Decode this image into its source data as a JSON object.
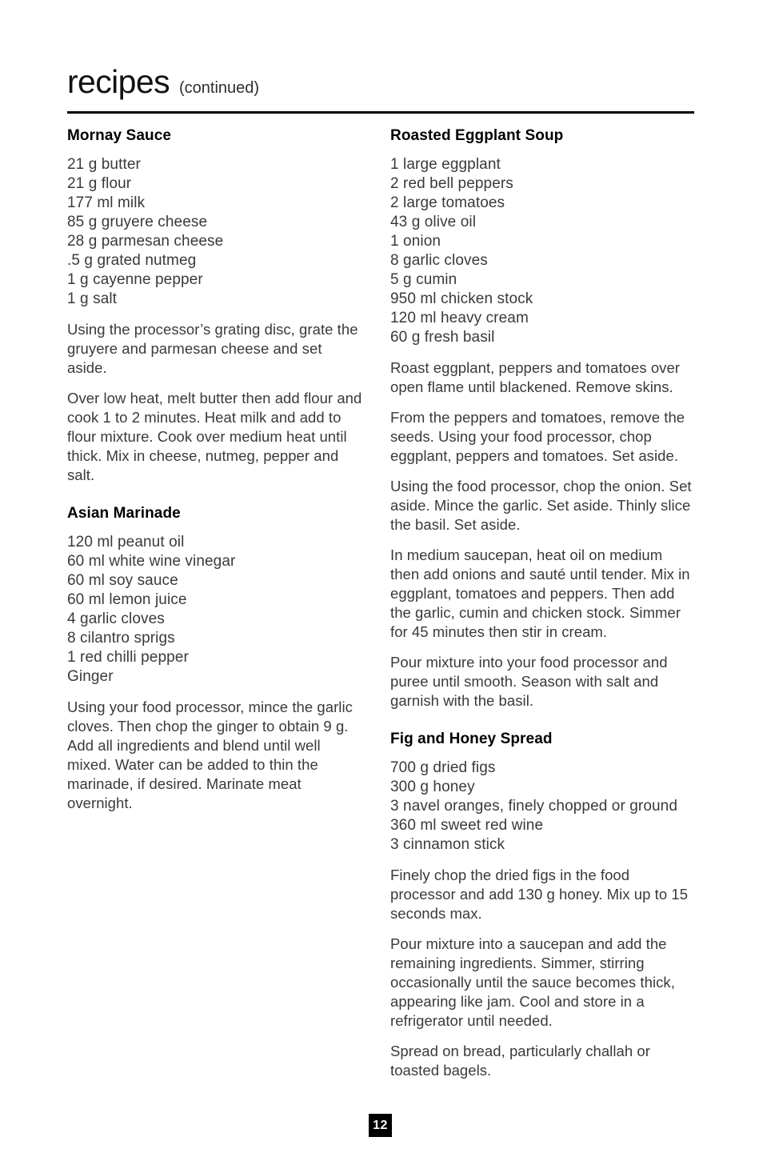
{
  "header": {
    "title": "recipes",
    "subtitle": "(continued)"
  },
  "columns": {
    "left": [
      {
        "title": "Mornay Sauce",
        "ingredients": [
          "21 g butter",
          "21 g flour",
          "177 ml milk",
          "85 g gruyere cheese",
          "28 g parmesan cheese",
          ".5 g grated nutmeg",
          "1 g cayenne pepper",
          "1 g salt"
        ],
        "steps": [
          "Using the processor’s grating disc, grate the gruyere and parmesan cheese and set aside.",
          "Over low heat, melt butter then add flour and cook 1 to 2 minutes.  Heat milk and add to flour mixture.  Cook over medium heat until thick.  Mix in cheese, nutmeg, pepper and salt."
        ]
      },
      {
        "title": "Asian Marinade",
        "ingredients": [
          "120 ml peanut oil",
          "60 ml white wine vinegar",
          "60 ml soy sauce",
          "60 ml lemon juice",
          "4 garlic cloves",
          "8 cilantro sprigs",
          "1 red chilli pepper",
          "Ginger"
        ],
        "steps": [
          "Using your food processor, mince the garlic cloves. Then chop the ginger to obtain 9 g. Add all ingredients and blend until well mixed. Water can be added to thin the marinade, if desired.  Marinate meat overnight."
        ]
      }
    ],
    "right": [
      {
        "title": "Roasted Eggplant Soup",
        "ingredients": [
          "1 large eggplant",
          "2 red bell peppers",
          "2 large tomatoes",
          "43 g olive oil",
          "1 onion",
          "8 garlic cloves",
          "5 g cumin",
          "950 ml chicken stock",
          "120 ml heavy cream",
          "60 g fresh basil"
        ],
        "steps": [
          "Roast eggplant, peppers and tomatoes over open flame until blackened.  Remove skins.",
          "From the peppers and tomatoes, remove the seeds.  Using your food processor, chop eggplant, peppers and tomatoes.  Set aside.",
          "Using the food processor, chop the onion. Set aside.  Mince the garlic.  Set aside. Thinly slice the basil.  Set aside.",
          "In medium saucepan, heat oil on medium then add onions and sauté until tender.  Mix in eggplant, tomatoes and peppers.  Then add the garlic, cumin and chicken stock. Simmer for 45 minutes then stir in cream.",
          "Pour mixture into your food processor and puree until smooth.  Season with salt and garnish with the basil."
        ]
      },
      {
        "title": "Fig and Honey Spread",
        "ingredients": [
          "700 g dried figs",
          "300 g honey",
          "3 navel oranges, finely chopped or ground",
          "360 ml sweet red wine",
          "3 cinnamon stick"
        ],
        "steps": [
          "Finely chop the dried figs in the food processor and add 130 g honey. Mix up to 15 seconds max.",
          "Pour mixture into a saucepan and add the remaining ingredients.  Simmer, stirring occasionally until the sauce becomes thick, appearing like jam.  Cool and store in a refrigerator until needed.",
          "Spread on bread, particularly challah or toasted bagels."
        ]
      }
    ]
  },
  "footer": {
    "page_number": "12"
  },
  "colors": {
    "rule": "#000000",
    "heading": "#000000",
    "body": "#3a3a3a",
    "badge_bg": "#000000",
    "badge_text": "#ffffff"
  }
}
